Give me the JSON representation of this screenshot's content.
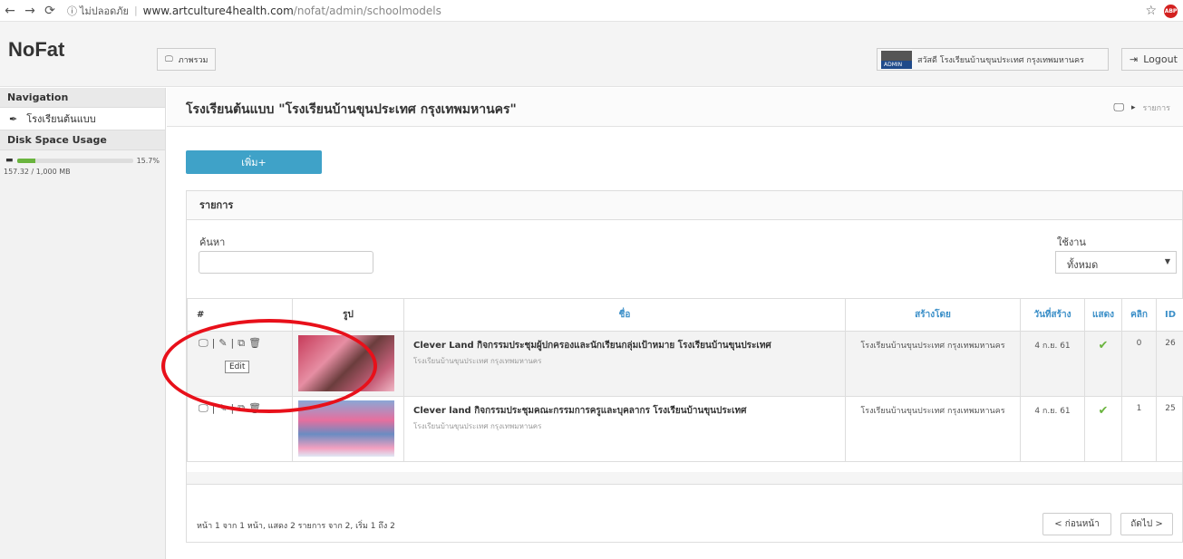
{
  "browser": {
    "security_text": "ไม่ปลอดภัย",
    "url_domain": "www.artculture4health.com",
    "url_path": "/nofat/admin/schoolmodels",
    "adblock_label": "ABP"
  },
  "header": {
    "brand": "NoFat",
    "overview_label": "ภาพรวม",
    "user_greeting": "สวัสดี โรงเรียนบ้านขุนประเทศ กรุงเทพมหานคร",
    "logout_label": "Logout"
  },
  "sidebar": {
    "nav_heading": "Navigation",
    "nav_item": "โรงเรียนต้นแบบ",
    "disk_heading": "Disk Space Usage",
    "disk_percent": "15.7%",
    "disk_fraction": 0.157,
    "disk_usage": "157.32 / 1,000 MB"
  },
  "page": {
    "title": "โรงเรียนต้นแบบ \"โรงเรียนบ้านขุนประเทศ กรุงเทพมหานคร\"",
    "breadcrumb": "รายการ",
    "add_button": "เพิ่ม+"
  },
  "panel": {
    "heading": "รายการ",
    "search_label": "ค้นหา",
    "search_value": "",
    "status_label": "ใช้งาน",
    "status_value": "ทั้งหมด"
  },
  "table": {
    "columns": [
      "#",
      "รูป",
      "ชื่อ",
      "สร้างโดย",
      "วันที่สร้าง",
      "แสดง",
      "คลิก",
      "ID"
    ],
    "rows": [
      {
        "title": "Clever Land กิจกรรมประชุมผู้ปกครองและนักเรียนกลุ่มเป้าหมาย โรงเรียนบ้านขุนประเทศ",
        "subtitle": "โรงเรียนบ้านขุนประเทศ กรุงเทพมหานคร",
        "created_by": "โรงเรียนบ้านขุนประเทศ กรุงเทพมหานคร",
        "date": "4 ก.ย. 61",
        "clicks": "0",
        "id": "26"
      },
      {
        "title": "Clever land กิจกรรมประชุมคณะกรรมการครูและบุคลากร โรงเรียนบ้านขุนประเทศ",
        "subtitle": "โรงเรียนบ้านขุนประเทศ กรุงเทพมหานคร",
        "created_by": "โรงเรียนบ้านขุนประเทศ กรุงเทพมหานคร",
        "date": "4 ก.ย. 61",
        "clicks": "1",
        "id": "25"
      }
    ]
  },
  "tooltip": "Edit",
  "pager": {
    "info": "หน้า 1 จาก 1 หน้า, แสดง 2 รายการ จาก 2, เริ่ม 1 ถึง 2",
    "prev": "< ก่อนหน้า",
    "next": "ถัดไป >"
  }
}
